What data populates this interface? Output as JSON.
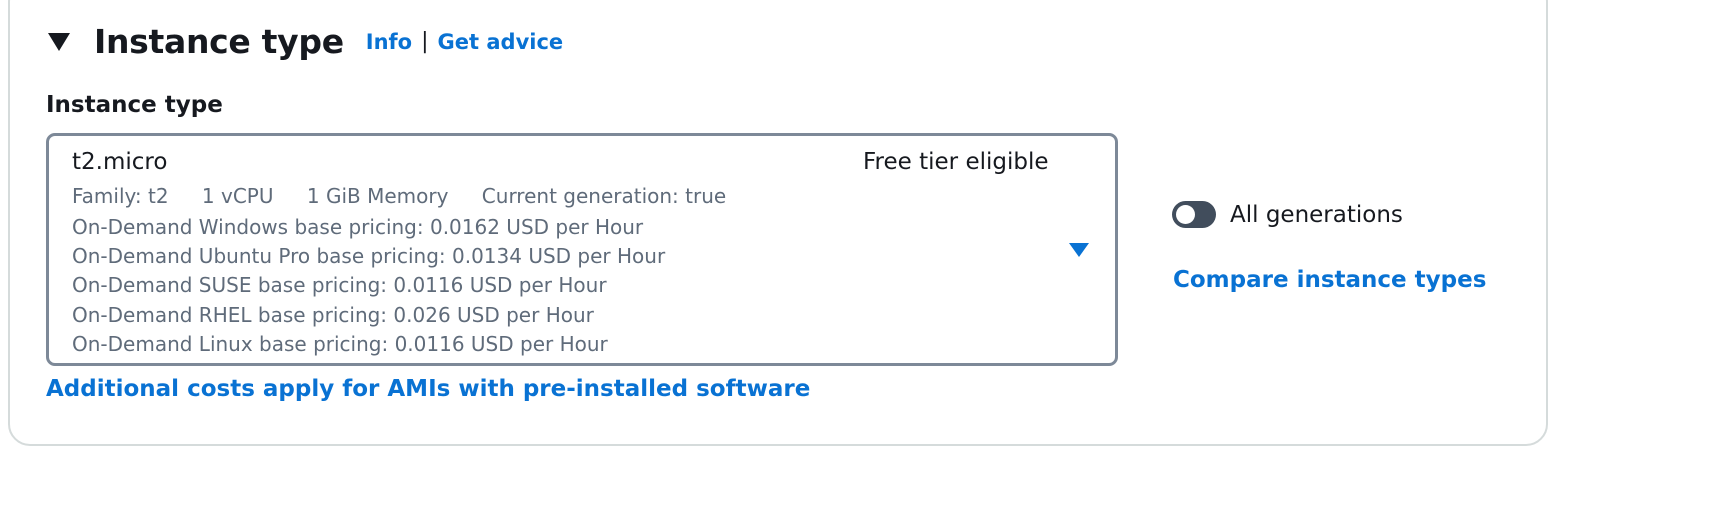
{
  "section": {
    "title": "Instance type",
    "info_link": "Info",
    "separator": "|",
    "advice_link": "Get advice"
  },
  "field": {
    "label": "Instance type"
  },
  "selected_instance": {
    "name": "t2.micro",
    "badge": "Free tier eligible",
    "family": "Family: t2",
    "vcpu": "1 vCPU",
    "memory": "1 GiB Memory",
    "generation": "Current generation: true",
    "pricing": [
      "On-Demand Windows base pricing: 0.0162 USD per Hour",
      "On-Demand Ubuntu Pro base pricing: 0.0134 USD per Hour",
      "On-Demand SUSE base pricing: 0.0116 USD per Hour",
      "On-Demand RHEL base pricing: 0.026 USD per Hour",
      "On-Demand Linux base pricing: 0.0116 USD per Hour"
    ]
  },
  "additional_costs_link": "Additional costs apply for AMIs with pre-installed software",
  "all_generations": {
    "label": "All generations",
    "enabled": false
  },
  "compare_link": "Compare instance types",
  "colors": {
    "link": "#0972d3",
    "text": "#16191f",
    "secondary_text": "#5f6b7a",
    "select_border": "#7d8998",
    "toggle_off": "#414d5c"
  },
  "icons": {
    "collapse": "caret-down-filled",
    "dropdown": "caret-down-filled"
  }
}
